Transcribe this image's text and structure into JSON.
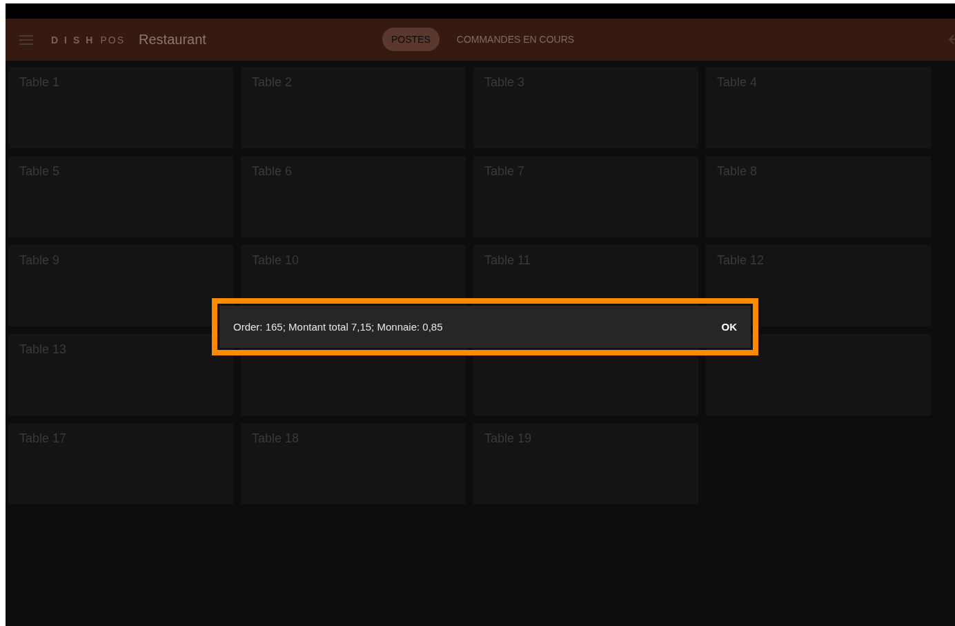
{
  "header": {
    "logo": {
      "brand": "DISH",
      "product": "POS"
    },
    "title": "Restaurant",
    "tabs": [
      {
        "label": "POSTES",
        "selected": true
      },
      {
        "label": "COMMANDES EN COURS",
        "selected": false
      }
    ]
  },
  "tables": [
    {
      "kind": "table",
      "label": "Table 1"
    },
    {
      "kind": "table",
      "label": "Table 2"
    },
    {
      "kind": "table",
      "label": "Table 3"
    },
    {
      "kind": "table",
      "label": "Table 4"
    },
    {
      "kind": "table",
      "label": "Table 5"
    },
    {
      "kind": "table",
      "label": "Table 6"
    },
    {
      "kind": "table",
      "label": "Table 7"
    },
    {
      "kind": "table",
      "label": "Table 8"
    },
    {
      "kind": "table",
      "label": "Table 9"
    },
    {
      "kind": "table",
      "label": "Table 10"
    },
    {
      "kind": "table",
      "label": "Table 11"
    },
    {
      "kind": "table",
      "label": "Table 12"
    },
    {
      "kind": "table",
      "label": "Table 13"
    },
    {
      "kind": "covered"
    },
    {
      "kind": "covered"
    },
    {
      "kind": "covered"
    },
    {
      "kind": "table",
      "label": "Table 17"
    },
    {
      "kind": "table",
      "label": "Table 18"
    },
    {
      "kind": "table",
      "label": "Table 19"
    }
  ],
  "snackbar": {
    "message": "Order: 165; Montant total 7,15; Monnaie: 0,85",
    "action": "OK",
    "highlighted": true
  }
}
